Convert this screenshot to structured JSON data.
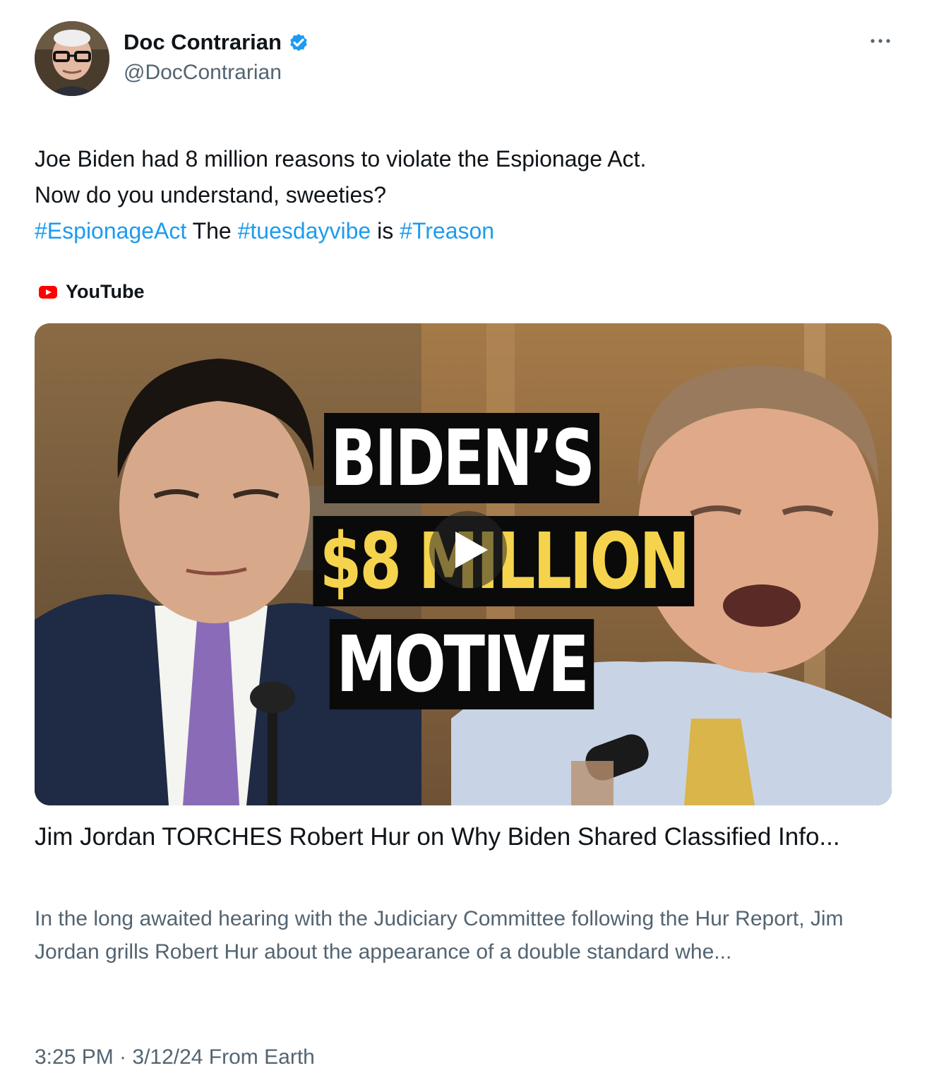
{
  "author": {
    "display_name": "Doc Contrarian",
    "handle": "@DocContrarian",
    "verified": true
  },
  "tweet": {
    "line1": "Joe Biden had 8 million reasons to violate the Espionage Act.",
    "line2": "Now do you understand, sweeties?",
    "hashtag1": "#EspionageAct",
    "text_the": "The",
    "hashtag2": "#tuesdayvibe",
    "text_is": "is",
    "hashtag3": "#Treason"
  },
  "card": {
    "source": "YouTube",
    "thumbnail_text": {
      "line1": "BIDEN’S",
      "line2_a": "$8",
      "line2_b": "MILLION",
      "line3": "MOTIVE"
    },
    "title": "Jim Jordan TORCHES Robert Hur on Why Biden Shared Classified Info...",
    "description": "In the long awaited hearing with the Judiciary Committee following the Hur Report, Jim Jordan grills Robert Hur about the appearance of a double standard whe..."
  },
  "footer": {
    "timestamp": "3:25 PM · 3/12/24 From Earth"
  },
  "icons": {
    "verified": "verified-badge-icon",
    "more": "more-options-icon",
    "youtube": "youtube-icon",
    "play": "play-icon"
  },
  "colors": {
    "link": "#1d9bf0",
    "text": "#0f1419",
    "muted": "#536471",
    "thumb_yellow": "#f5d34c",
    "youtube_red": "#ff0000"
  }
}
